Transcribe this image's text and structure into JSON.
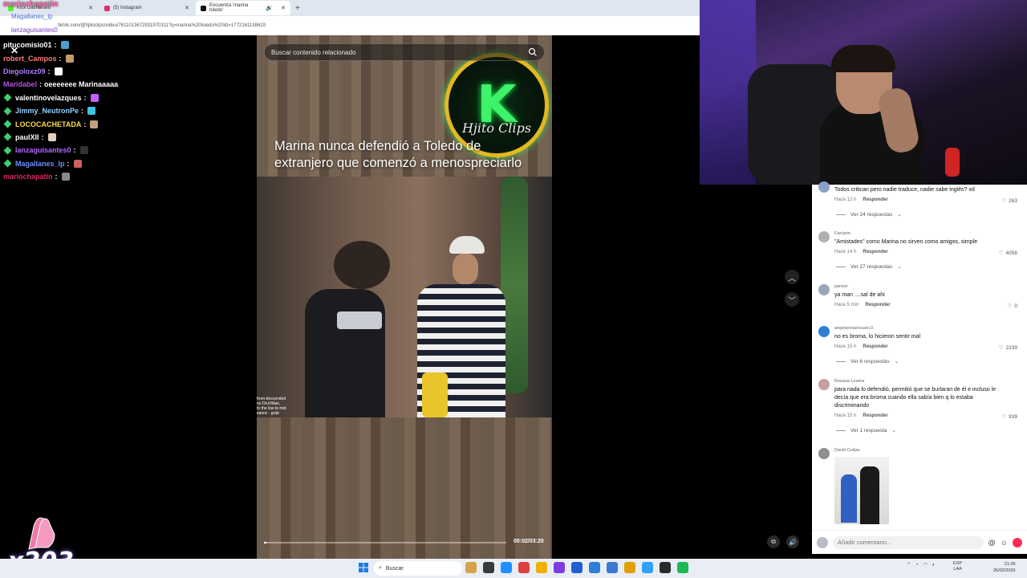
{
  "browser": {
    "tabs": [
      {
        "label": "Kick Dashboard",
        "color": "#53fc18"
      },
      {
        "label": "(5) Instagram",
        "color": "#e1306c"
      },
      {
        "label": "Encuentra 'marina toledo'",
        "color": "#111111"
      }
    ],
    "address": "tiktok.com/@hjitoclips/video/7611013672931970311?q=marina%20toledo%20&t=1772161138619"
  },
  "chat": {
    "channel": "mariochapatin",
    "pinned_1": "Magallanes_lp",
    "pinned_2": "lanzaguisantes0",
    "messages": [
      {
        "user": "pitucomisio01",
        "color": "#ffffff",
        "badge": false,
        "text": "",
        "emote": "#4aa0d0"
      },
      {
        "user": "robert_Campos",
        "color": "#ff7a7a",
        "badge": false,
        "text": "",
        "emote": "#c49a6c"
      },
      {
        "user": "Diegoloxz09",
        "color": "#b07aff",
        "badge": false,
        "text": "",
        "emote": "#ffffff"
      },
      {
        "user": "Maridabel",
        "color": "#b44fe0",
        "badge": false,
        "text": "oeeeeeee Marinaaaaa",
        "emote": ""
      },
      {
        "user": "valentinovelazques",
        "color": "#ffffff",
        "badge": true,
        "text": "",
        "emote": "#c060ff"
      },
      {
        "user": "Jimmy_NeutronPe",
        "color": "#8fd0ff",
        "badge": true,
        "text": "",
        "emote": "#40c0e0"
      },
      {
        "user": "LOCOCACHETADA",
        "color": "#ffd84a",
        "badge": true,
        "text": "",
        "emote": "#c0a080"
      },
      {
        "user": "paulXII",
        "color": "#ffffff",
        "badge": true,
        "text": "",
        "emote": "#e0d0c0"
      },
      {
        "user": "lanzaguisantes0",
        "color": "#b06cff",
        "badge": true,
        "text": "",
        "emote": "#333333"
      },
      {
        "user": "Magallanes_lp",
        "color": "#6f8fff",
        "badge": true,
        "text": "",
        "emote": "#d06060"
      },
      {
        "user": "mariochapatin",
        "color": "#e0245e",
        "badge": false,
        "text": "",
        "emote": "#888888"
      }
    ]
  },
  "video": {
    "search_placeholder": "Buscar contenido relacionado",
    "caption": "Marina nunca defendió a Toledo de extranjero que comenzó a menospreciarlo",
    "logo_text": "Hjito Clips",
    "scene_text": "from-descended\nno DruVMan,\nto the low to mid\nsance - grab",
    "timecode": "00:02/03:20",
    "progress": 0.01
  },
  "comments": [
    {
      "user": "",
      "text": "Todos critican pero nadie traduce, nadie sabe inglés? xd",
      "time": "Hace 12 h",
      "reply": "Responder",
      "likes": "263",
      "replies": "Ver 24 respuestas",
      "avatar": "#8aa0c8"
    },
    {
      "user": "Fanlann",
      "text": "\"Amistades\" como Marina no sirven como amigos, simple",
      "time": "Hace 14 h",
      "reply": "Responder",
      "likes": "4056",
      "replies": "Ver 27 respuestas",
      "avatar": "#b0b0b0"
    },
    {
      "user": "panzer",
      "text": "ya man ....sal de ahi",
      "time": "Hace 5 min",
      "reply": "Responder",
      "likes": "0",
      "replies": "",
      "avatar": "#9aa6b8"
    },
    {
      "user": "angelarosariosanc3",
      "text": "no es broma, lo hicieron sentir mal",
      "time": "Hace 15 h",
      "reply": "Responder",
      "likes": "2239",
      "replies": "Ver 6 respuestas",
      "avatar": "#2f7fd8"
    },
    {
      "user": "Roxana Lovera",
      "text": "para nada lo defendió, permitió que se burlaran de él e incluso le decía que era broma cuando ella sabía bien q lo estaba discriminando",
      "time": "Hace 15 h",
      "reply": "Responder",
      "likes": "939",
      "replies": "Ver 1 respuesta",
      "avatar": "#c8a0a0"
    },
    {
      "user": "David Cutipa",
      "text": "",
      "time": "",
      "reply": "",
      "likes": "",
      "replies": "",
      "avatar": "#909090"
    }
  ],
  "comment_input": {
    "placeholder": "Añadir comentario..."
  },
  "overlay": {
    "combo": "x203"
  },
  "taskbar": {
    "search": "Buscar",
    "lang": "ESP\nLAA",
    "time": "21:39",
    "date": "26/02/2026"
  }
}
